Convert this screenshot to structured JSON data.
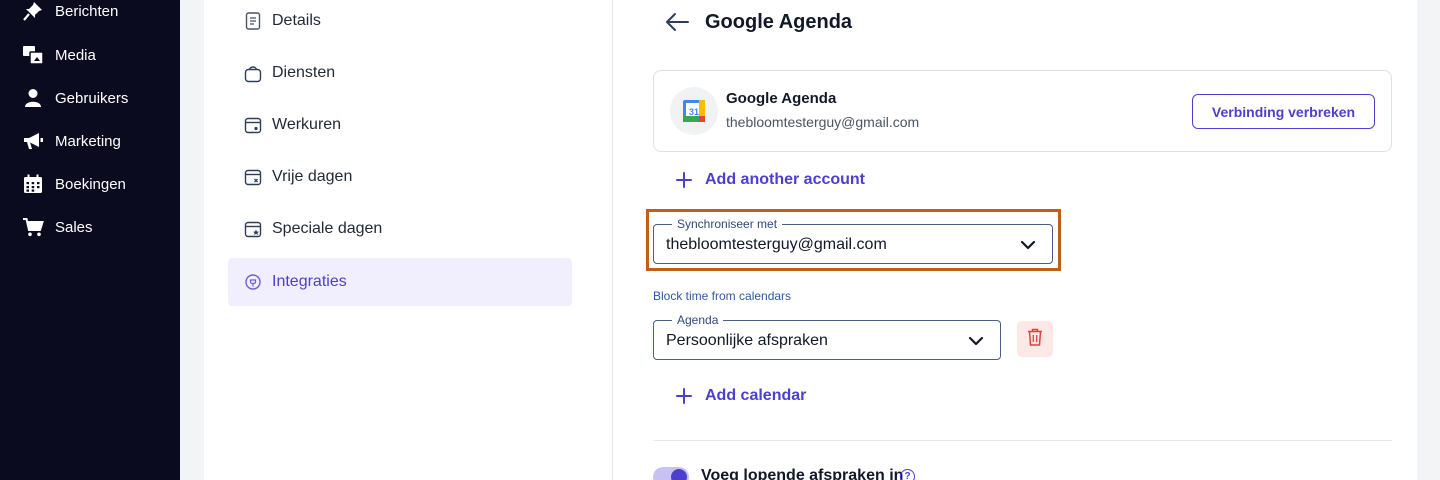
{
  "sidebar": {
    "items": [
      {
        "label": "Berichten",
        "icon": "pin-icon"
      },
      {
        "label": "Media",
        "icon": "media-icon"
      },
      {
        "label": "Gebruikers",
        "icon": "user-icon"
      },
      {
        "label": "Marketing",
        "icon": "megaphone-icon"
      },
      {
        "label": "Boekingen",
        "icon": "calendar-icon"
      },
      {
        "label": "Sales",
        "icon": "cart-icon"
      }
    ]
  },
  "settings_menu": {
    "items": [
      {
        "label": "Details",
        "icon": "document-icon",
        "active": false
      },
      {
        "label": "Diensten",
        "icon": "bag-icon",
        "active": false
      },
      {
        "label": "Werkuren",
        "icon": "calendar-clock-icon",
        "active": false
      },
      {
        "label": "Vrije dagen",
        "icon": "calendar-x-icon",
        "active": false
      },
      {
        "label": "Speciale dagen",
        "icon": "calendar-star-icon",
        "active": false
      },
      {
        "label": "Integraties",
        "icon": "integration-icon",
        "active": true
      }
    ]
  },
  "main": {
    "title": "Google Agenda",
    "account": {
      "name": "Google Agenda",
      "email": "thebloomtesterguy@gmail.com",
      "disconnect_label": "Verbinding verbreken",
      "calendar_day": "31"
    },
    "add_account_label": "Add another account",
    "sync": {
      "label": "Synchroniseer met",
      "value": "thebloomtesterguy@gmail.com"
    },
    "block_time_label": "Block time from calendars",
    "agenda": {
      "label": "Agenda",
      "value": "Persoonlijke afspraken"
    },
    "add_calendar_label": "Add calendar",
    "toggle": {
      "label": "Voeg lopende afspraken in",
      "enabled": true
    },
    "help_glyph": "?"
  },
  "colors": {
    "accent": "#4c3fd0",
    "sidebar_bg": "#0b0b1f",
    "highlight": "#c05f1a",
    "danger": "#e53e3e"
  }
}
